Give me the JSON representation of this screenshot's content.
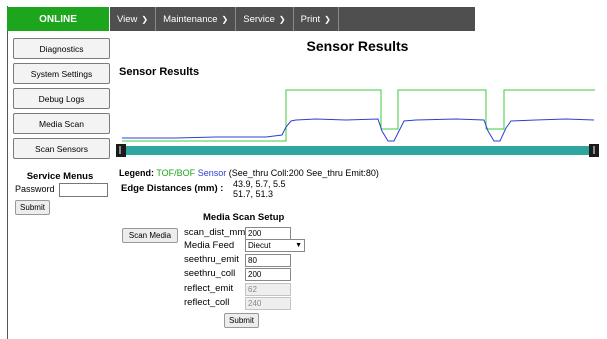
{
  "status": "ONLINE",
  "colors": {
    "status_bg": "#1ea51e",
    "nav_bg": "#4f4f4f",
    "blue_trace": "#2b3fd6",
    "green_trace": "#3ccc3c",
    "scale_bar": "#2fa5a0"
  },
  "nav": [
    "View",
    "Maintenance",
    "Service",
    "Print"
  ],
  "sidebar": [
    "Diagnostics",
    "System Settings",
    "Debug Logs",
    "Media Scan",
    "Scan Sensors"
  ],
  "service": {
    "title": "Service Menus",
    "password_label": "Password",
    "submit": "Submit"
  },
  "page_title": "Sensor Results",
  "section_title": "Sensor Results",
  "legend": {
    "label": "Legend:",
    "tof": "TOF/BOF",
    "sensor": "Sensor",
    "note": "(See_thru Coll:200 See_thru Emit:80)"
  },
  "edge": {
    "label": "Edge Distances (mm) :",
    "line1": "43.9, 5.7, 5.5",
    "line2": "51.7, 51.3"
  },
  "setup": {
    "title": "Media Scan Setup",
    "scan_button": "Scan Media",
    "fields": [
      {
        "label": "scan_dist_mm",
        "value": "200"
      },
      {
        "label": "Media Feed",
        "value": "Diecut"
      },
      {
        "label": "seethru_emit",
        "value": "80"
      },
      {
        "label": "seethru_coll",
        "value": "200"
      },
      {
        "label": "reflect_emit",
        "value": "62"
      },
      {
        "label": "reflect_coll",
        "value": "240"
      }
    ],
    "submit": "Submit"
  }
}
